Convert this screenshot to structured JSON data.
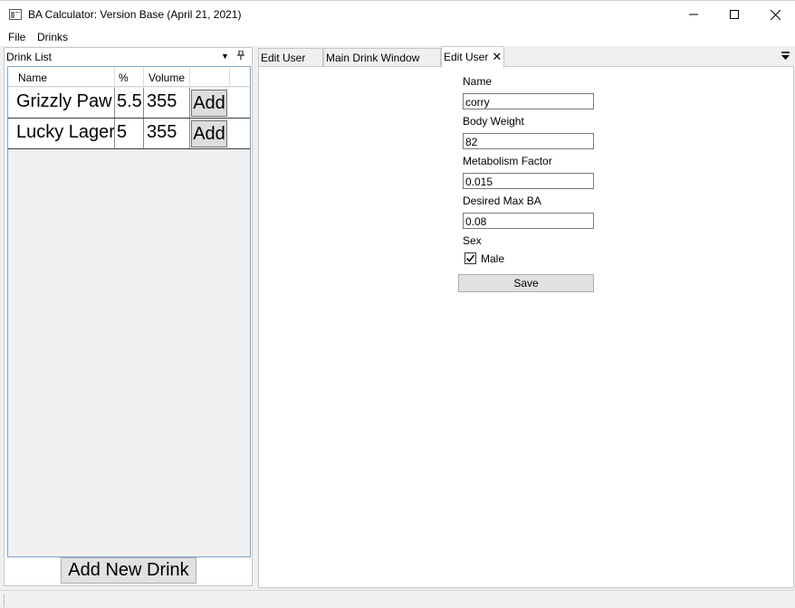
{
  "window": {
    "title": "BA Calculator: Version Base (April 21, 2021)",
    "minimize_icon": "minimize-icon",
    "maximize_icon": "maximize-icon",
    "close_icon": "close-icon"
  },
  "menu": {
    "items": [
      {
        "label": "File"
      },
      {
        "label": "Drinks"
      }
    ]
  },
  "drink_pane": {
    "title": "Drink List",
    "columns": [
      "Name",
      "%",
      "Volume",
      ""
    ],
    "rows": [
      {
        "name": "Grizzly Paw",
        "percent": "5.5",
        "volume": "355",
        "action": "Add"
      },
      {
        "name": "Lucky Lager",
        "percent": "5",
        "volume": "355",
        "action": "Add"
      }
    ],
    "add_new_label": "Add New Drink"
  },
  "tabs": [
    {
      "label": "Edit User",
      "active": false
    },
    {
      "label": "Main Drink Window",
      "active": false
    },
    {
      "label": "Edit User",
      "active": true,
      "close": "✕"
    }
  ],
  "form": {
    "name_label": "Name",
    "name_value": "corry",
    "weight_label": "Body Weight",
    "weight_value": "82",
    "metabolism_label": "Metabolism Factor",
    "metabolism_value": "0.015",
    "max_ba_label": "Desired Max BA",
    "max_ba_value": "0.08",
    "sex_label": "Sex",
    "male_label": "Male",
    "male_checked": true,
    "save_label": "Save"
  }
}
